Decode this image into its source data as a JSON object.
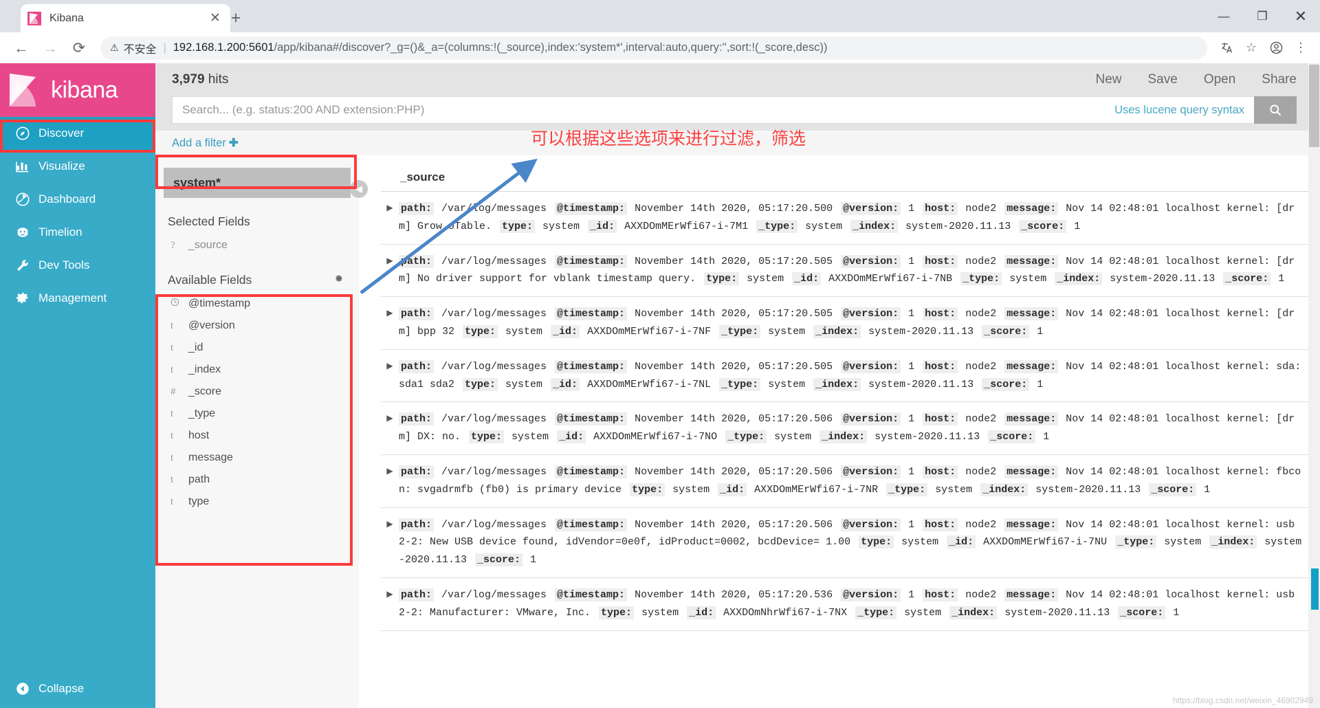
{
  "browser": {
    "tab": {
      "title": "Kibana",
      "favicon": "kibana-favicon",
      "close": "✕"
    },
    "newtab_label": "+",
    "window_controls": {
      "minimize": "—",
      "maximize": "❐",
      "close": "✕"
    },
    "nav": {
      "back": "←",
      "forward": "→",
      "reload": "⟳"
    },
    "security": {
      "icon": "⚠",
      "label": "不安全"
    },
    "url_host": "192.168.1.200:5601",
    "url_path": "/app/kibana#/discover?_g=()&_a=(columns:!(_source),index:'system*',interval:auto,query:'',sort:!(_score,desc))",
    "omni_icons": {
      "translate": "文A",
      "bookmark": "☆",
      "profile": "●",
      "menu": "⋮"
    }
  },
  "kibana": {
    "brand": "kibana",
    "nav_items": [
      {
        "label": "Discover",
        "icon": "compass-icon",
        "active": true
      },
      {
        "label": "Visualize",
        "icon": "bar-chart-icon",
        "active": false
      },
      {
        "label": "Dashboard",
        "icon": "dashboard-icon",
        "active": false
      },
      {
        "label": "Timelion",
        "icon": "timelion-icon",
        "active": false
      },
      {
        "label": "Dev Tools",
        "icon": "wrench-icon",
        "active": false
      },
      {
        "label": "Management",
        "icon": "gear-icon",
        "active": false
      }
    ],
    "collapse_label": "Collapse",
    "hits_count": "3,979",
    "hits_label": "hits",
    "topnav": [
      "New",
      "Save",
      "Open",
      "Share"
    ],
    "search_placeholder": "Search... (e.g. status:200 AND extension:PHP)",
    "search_value": "",
    "lucene_hint": "Uses lucene query syntax",
    "search_icon": "🔍",
    "add_filter": "Add a filter",
    "add_filter_plus": "➕",
    "index_pattern": "system*",
    "selected_fields_title": "Selected Fields",
    "selected_fields": [
      {
        "type": "?",
        "name": "_source"
      }
    ],
    "available_fields_title": "Available Fields",
    "available_fields": [
      {
        "type": "◴",
        "name": "@timestamp"
      },
      {
        "type": "t",
        "name": "@version"
      },
      {
        "type": "t",
        "name": "_id"
      },
      {
        "type": "t",
        "name": "_index"
      },
      {
        "type": "#",
        "name": "_score"
      },
      {
        "type": "t",
        "name": "_type"
      },
      {
        "type": "t",
        "name": "host"
      },
      {
        "type": "t",
        "name": "message"
      },
      {
        "type": "t",
        "name": "path"
      },
      {
        "type": "t",
        "name": "type"
      }
    ],
    "doc_column_header": "_source",
    "documents": [
      {
        "path": "/var/log/messages",
        "timestamp": "November 14th 2020, 05:17:20.500",
        "version": "1",
        "host": "node2",
        "message": "Nov 14 02:48:01 localhost kernel: [drm] Grow oTable.",
        "type": "system",
        "id": "AXXDOmMErWfi67-i-7M1",
        "_type": "system",
        "_index": "system-2020.11.13",
        "score": "1"
      },
      {
        "path": "/var/log/messages",
        "timestamp": "November 14th 2020, 05:17:20.505",
        "version": "1",
        "host": "node2",
        "message": "Nov 14 02:48:01 localhost kernel: [drm] No driver support for vblank timestamp query.",
        "type": "system",
        "id": "AXXDOmMErWfi67-i-7NB",
        "_type": "system",
        "_index": "system-2020.11.13",
        "score": "1"
      },
      {
        "path": "/var/log/messages",
        "timestamp": "November 14th 2020, 05:17:20.505",
        "version": "1",
        "host": "node2",
        "message": "Nov 14 02:48:01 localhost kernel: [drm] bpp 32",
        "type": "system",
        "id": "AXXDOmMErWfi67-i-7NF",
        "_type": "system",
        "_index": "system-2020.11.13",
        "score": "1"
      },
      {
        "path": "/var/log/messages",
        "timestamp": "November 14th 2020, 05:17:20.505",
        "version": "1",
        "host": "node2",
        "message": "Nov 14 02:48:01 localhost kernel: sda: sda1 sda2",
        "type": "system",
        "id": "AXXDOmMErWfi67-i-7NL",
        "_type": "system",
        "_index": "system-2020.11.13",
        "score": "1"
      },
      {
        "path": "/var/log/messages",
        "timestamp": "November 14th 2020, 05:17:20.506",
        "version": "1",
        "host": "node2",
        "message": "Nov 14 02:48:01 localhost kernel: [drm] DX: no.",
        "type": "system",
        "id": "AXXDOmMErWfi67-i-7NO",
        "_type": "system",
        "_index": "system-2020.11.13",
        "score": "1"
      },
      {
        "path": "/var/log/messages",
        "timestamp": "November 14th 2020, 05:17:20.506",
        "version": "1",
        "host": "node2",
        "message": "Nov 14 02:48:01 localhost kernel: fbcon: svgadrmfb (fb0) is primary device",
        "type": "system",
        "id": "AXXDOmMErWfi67-i-7NR",
        "_type": "system",
        "_index": "system-2020.11.13",
        "score": "1"
      },
      {
        "path": "/var/log/messages",
        "timestamp": "November 14th 2020, 05:17:20.506",
        "version": "1",
        "host": "node2",
        "message": "Nov 14 02:48:01 localhost kernel: usb 2-2: New USB device found, idVendor=0e0f, idProduct=0002, bcdDevice= 1.00",
        "type": "system",
        "id": "AXXDOmMErWfi67-i-7NU",
        "_type": "system",
        "_index": "system-2020.11.13",
        "score": "1"
      },
      {
        "path": "/var/log/messages",
        "timestamp": "November 14th 2020, 05:17:20.536",
        "version": "1",
        "host": "node2",
        "message": "Nov 14 02:48:01 localhost kernel: usb 2-2: Manufacturer: VMware, Inc.",
        "type": "system",
        "id": "AXXDOmNhrWfi67-i-7NX",
        "_type": "system",
        "_index": "system-2020.11.13",
        "score": "1"
      }
    ],
    "field_labels": {
      "path": "path:",
      "timestamp": "@timestamp:",
      "version": "@version:",
      "host": "host:",
      "message": "message:",
      "type": "type:",
      "id": "_id:",
      "dtype": "_type:",
      "index": "_index:",
      "score": "_score:"
    }
  },
  "annotations": {
    "note_text": "可以根据这些选项来进行过滤，筛选",
    "highlight_color": "#fb3b3b",
    "arrow_color": "#4a86c8",
    "watermark": "https://blog.csdn.net/weixin_46902949"
  }
}
